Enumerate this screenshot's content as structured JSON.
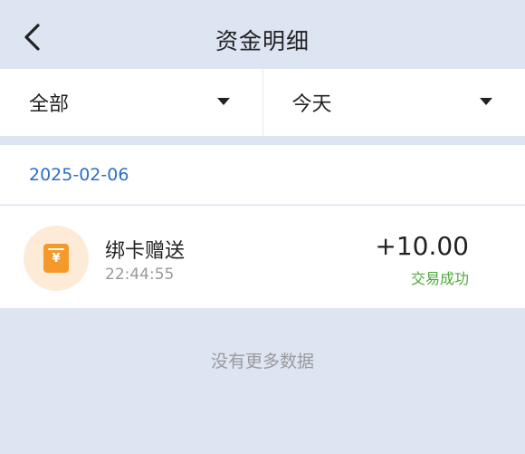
{
  "header": {
    "title": "资金明细",
    "back_icon": "chevron-left-icon"
  },
  "filters": {
    "type_selected": "全部",
    "date_selected": "今天",
    "dropdown_icon": "caret-down-icon"
  },
  "records": {
    "date": "2025-02-06",
    "items": [
      {
        "title": "绑卡赠送",
        "time": "22:44:55",
        "amount": "+10.00",
        "status": "交易成功",
        "icon": "red-envelope-yuan-icon"
      }
    ]
  },
  "footer": {
    "no_more_text": "没有更多数据"
  },
  "colors": {
    "background": "#dde5f3",
    "date_text": "#2a6fc9",
    "status_success": "#4caa3a",
    "icon_orange": "#f59a2a"
  }
}
